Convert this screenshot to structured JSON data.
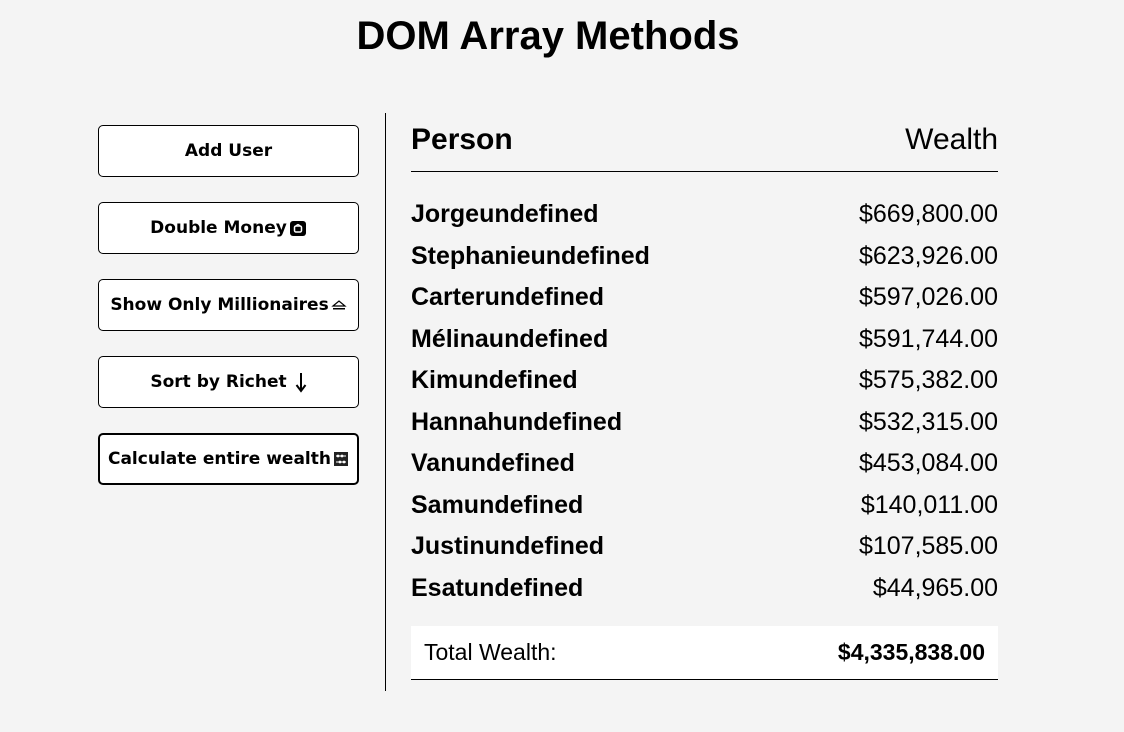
{
  "title": "DOM Array Methods",
  "buttons": [
    {
      "label": "Add User"
    },
    {
      "label": "Double Money",
      "icon": "money-icon"
    },
    {
      "label": "Show Only Millionaires",
      "icon": "eject-icon"
    },
    {
      "label": "Sort by Richet",
      "icon": "down-arrow-icon"
    },
    {
      "label": "Calculate entire wealth",
      "icon": "abacus-icon"
    }
  ],
  "table": {
    "person_header": "Person",
    "wealth_header": "Wealth",
    "rows": [
      {
        "name": "Jorgeundefined",
        "wealth": "$669,800.00"
      },
      {
        "name": "Stephanieundefined",
        "wealth": "$623,926.00"
      },
      {
        "name": "Carterundefined",
        "wealth": "$597,026.00"
      },
      {
        "name": "Mélinaundefined",
        "wealth": "$591,744.00"
      },
      {
        "name": "Kimundefined",
        "wealth": "$575,382.00"
      },
      {
        "name": "Hannahundefined",
        "wealth": "$532,315.00"
      },
      {
        "name": "Vanundefined",
        "wealth": "$453,084.00"
      },
      {
        "name": "Samundefined",
        "wealth": "$140,011.00"
      },
      {
        "name": "Justinundefined",
        "wealth": "$107,585.00"
      },
      {
        "name": "Esatundefined",
        "wealth": "$44,965.00"
      }
    ],
    "total_label": "Total Wealth:",
    "total_value": "$4,335,838.00"
  }
}
